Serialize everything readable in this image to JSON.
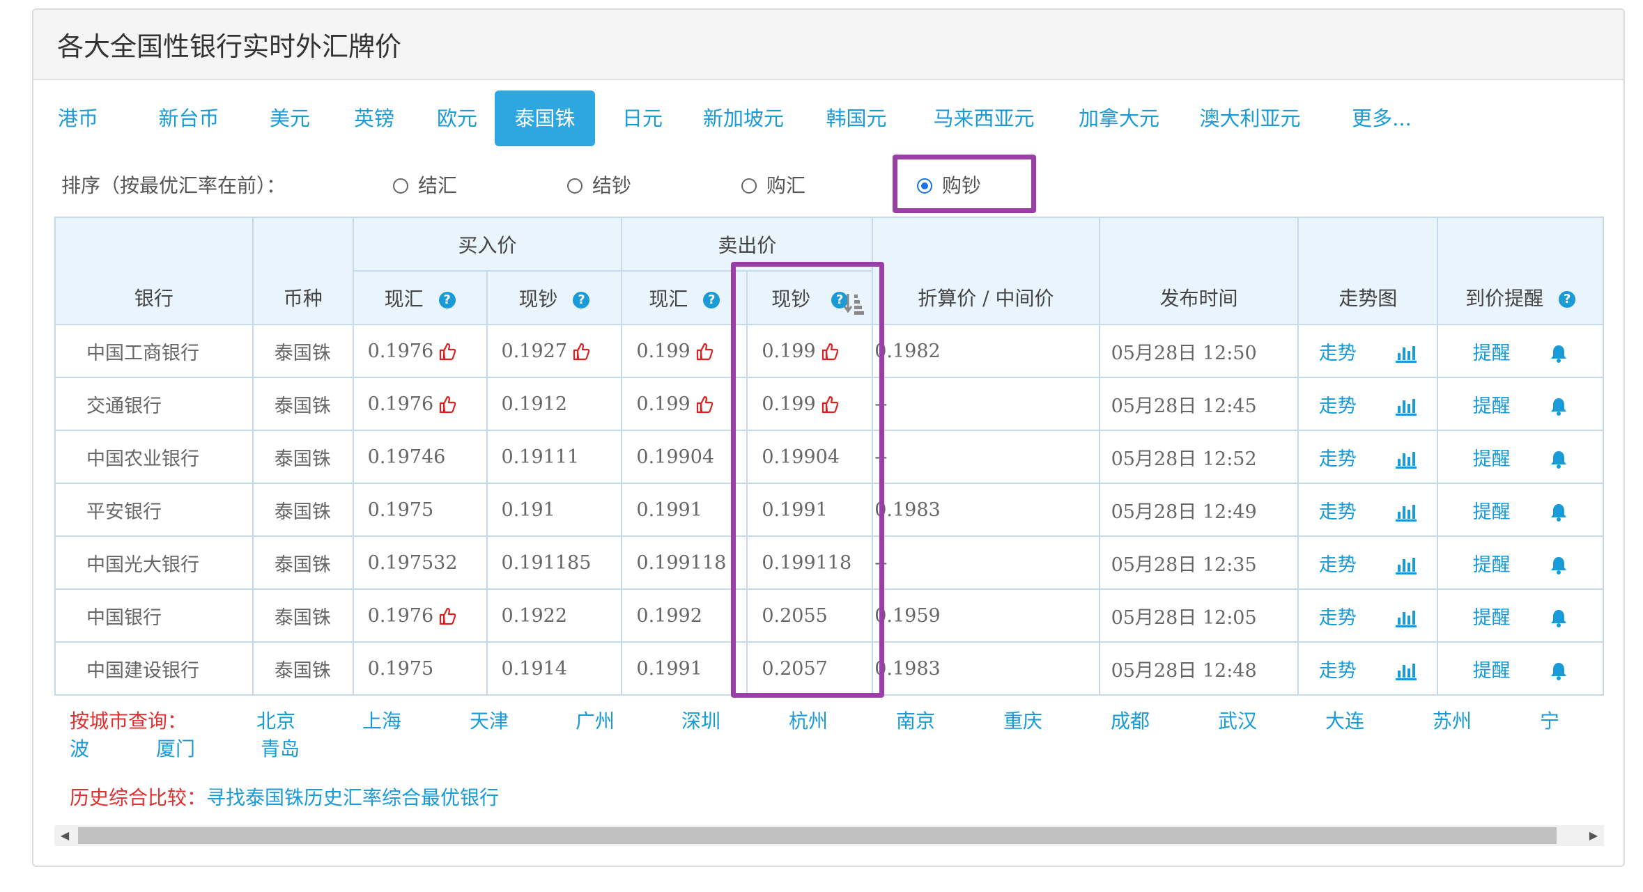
{
  "title": "各大全国性银行实时外汇牌价",
  "tabs": [
    "港币",
    "新台币",
    "美元",
    "英镑",
    "欧元",
    "泰国铢",
    "日元",
    "新加坡元",
    "韩国元",
    "马来西亚元",
    "加拿大元",
    "澳大利亚元",
    "更多..."
  ],
  "sort": {
    "label": "排序（按最优汇率在前）：",
    "options": [
      "结汇",
      "结钞",
      "购汇",
      "购钞"
    ],
    "selected": "购钞"
  },
  "table": {
    "headers": {
      "bank": "银行",
      "currency": "币种",
      "buy": "买入价",
      "sell": "卖出价",
      "spot": "现汇",
      "cash": "现钞",
      "mid": "折算价 / 中间价",
      "time": "发布时间",
      "trend": "走势图",
      "alert": "到价提醒"
    },
    "rows": [
      {
        "bank": "中国工商银行",
        "currency": "泰国铢",
        "buy_spot": "0.1976",
        "buy_cash": "0.1927",
        "sell_spot": "0.199",
        "sell_cash": "0.199",
        "mid": "0.1982",
        "time": "05月28日 12:50",
        "trend": "走势",
        "alert": "提醒"
      },
      {
        "bank": "交通银行",
        "currency": "泰国铢",
        "buy_spot": "0.1976",
        "buy_cash": "0.1912",
        "sell_spot": "0.199",
        "sell_cash": "0.199",
        "mid": "--",
        "time": "05月28日 12:45",
        "trend": "走势",
        "alert": "提醒"
      },
      {
        "bank": "中国农业银行",
        "currency": "泰国铢",
        "buy_spot": "0.19746",
        "buy_cash": "0.19111",
        "sell_spot": "0.19904",
        "sell_cash": "0.19904",
        "mid": "--",
        "time": "05月28日 12:52",
        "trend": "走势",
        "alert": "提醒"
      },
      {
        "bank": "平安银行",
        "currency": "泰国铢",
        "buy_spot": "0.1975",
        "buy_cash": "0.191",
        "sell_spot": "0.1991",
        "sell_cash": "0.1991",
        "mid": "0.1983",
        "time": "05月28日 12:49",
        "trend": "走势",
        "alert": "提醒"
      },
      {
        "bank": "中国光大银行",
        "currency": "泰国铢",
        "buy_spot": "0.197532",
        "buy_cash": "0.191185",
        "sell_spot": "0.199118",
        "sell_cash": "0.199118",
        "mid": "--",
        "time": "05月28日 12:35",
        "trend": "走势",
        "alert": "提醒"
      },
      {
        "bank": "中国银行",
        "currency": "泰国铢",
        "buy_spot": "0.1976",
        "buy_cash": "0.1922",
        "sell_spot": "0.1992",
        "sell_cash": "0.2055",
        "mid": "0.1959",
        "time": "05月28日 12:05",
        "trend": "走势",
        "alert": "提醒"
      },
      {
        "bank": "中国建设银行",
        "currency": "泰国铢",
        "buy_spot": "0.1975",
        "buy_cash": "0.1914",
        "sell_spot": "0.1991",
        "sell_cash": "0.2057",
        "mid": "0.1983",
        "time": "05月28日 12:48",
        "trend": "走势",
        "alert": "提醒"
      }
    ],
    "best_marks": [
      [
        "buy_spot",
        "buy_cash",
        "sell_spot",
        "sell_cash"
      ],
      [
        "buy_spot",
        "sell_spot",
        "sell_cash"
      ],
      [],
      [],
      [],
      [
        "buy_spot"
      ],
      []
    ]
  },
  "cities": {
    "label": "按城市查询：",
    "items": [
      "北京",
      "上海",
      "天津",
      "广州",
      "深圳",
      "杭州",
      "南京",
      "重庆",
      "成都",
      "武汉",
      "大连",
      "苏州",
      "宁",
      "波",
      "厦门",
      "青岛"
    ]
  },
  "history": {
    "label": "历史综合比较：",
    "link": "寻找泰国铢历史汇率综合最优银行"
  },
  "colors": {
    "accent": "#2ea6e0",
    "link": "#1a9ad6",
    "highlight": "#9b3ea8",
    "best": "#e02020",
    "header_bg": "#eaf4fd"
  }
}
